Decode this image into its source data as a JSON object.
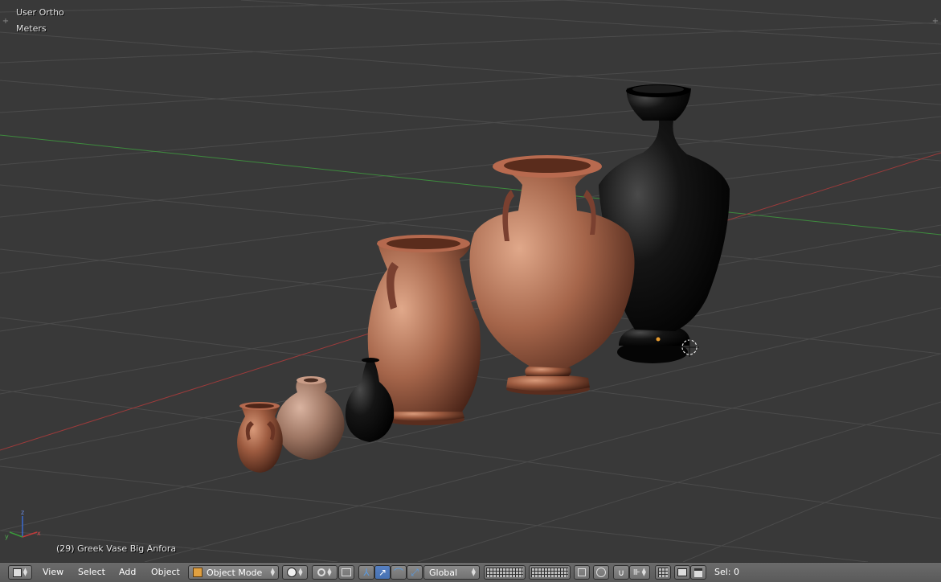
{
  "viewport": {
    "view_name": "User Ortho",
    "units": "Meters",
    "active_object": "(29) Greek Vase Big Anfora"
  },
  "header": {
    "menus": [
      "View",
      "Select",
      "Add",
      "Object"
    ],
    "mode": "Object Mode",
    "orientation": "Global",
    "selection_count": "Sel: 0"
  },
  "icons": {
    "editor_type": "3d-cube-icon",
    "mode": "object-cube-icon",
    "shading": "solid-sphere-icon",
    "pivot": "pivot-point-icon",
    "manipulator": "manipulator-icon",
    "snap": "magnet-icon",
    "render": "camera-icon"
  },
  "colors": {
    "viewport_bg": "#393939",
    "grid_line": "#4d4d4d",
    "x_axis": "#a33a3a",
    "y_axis": "#3a8a3a",
    "terracotta": "#9a5a40",
    "black_glaze": "#111111",
    "header_bg": "#5e5e5e",
    "selected_blue": "#5680c2"
  }
}
